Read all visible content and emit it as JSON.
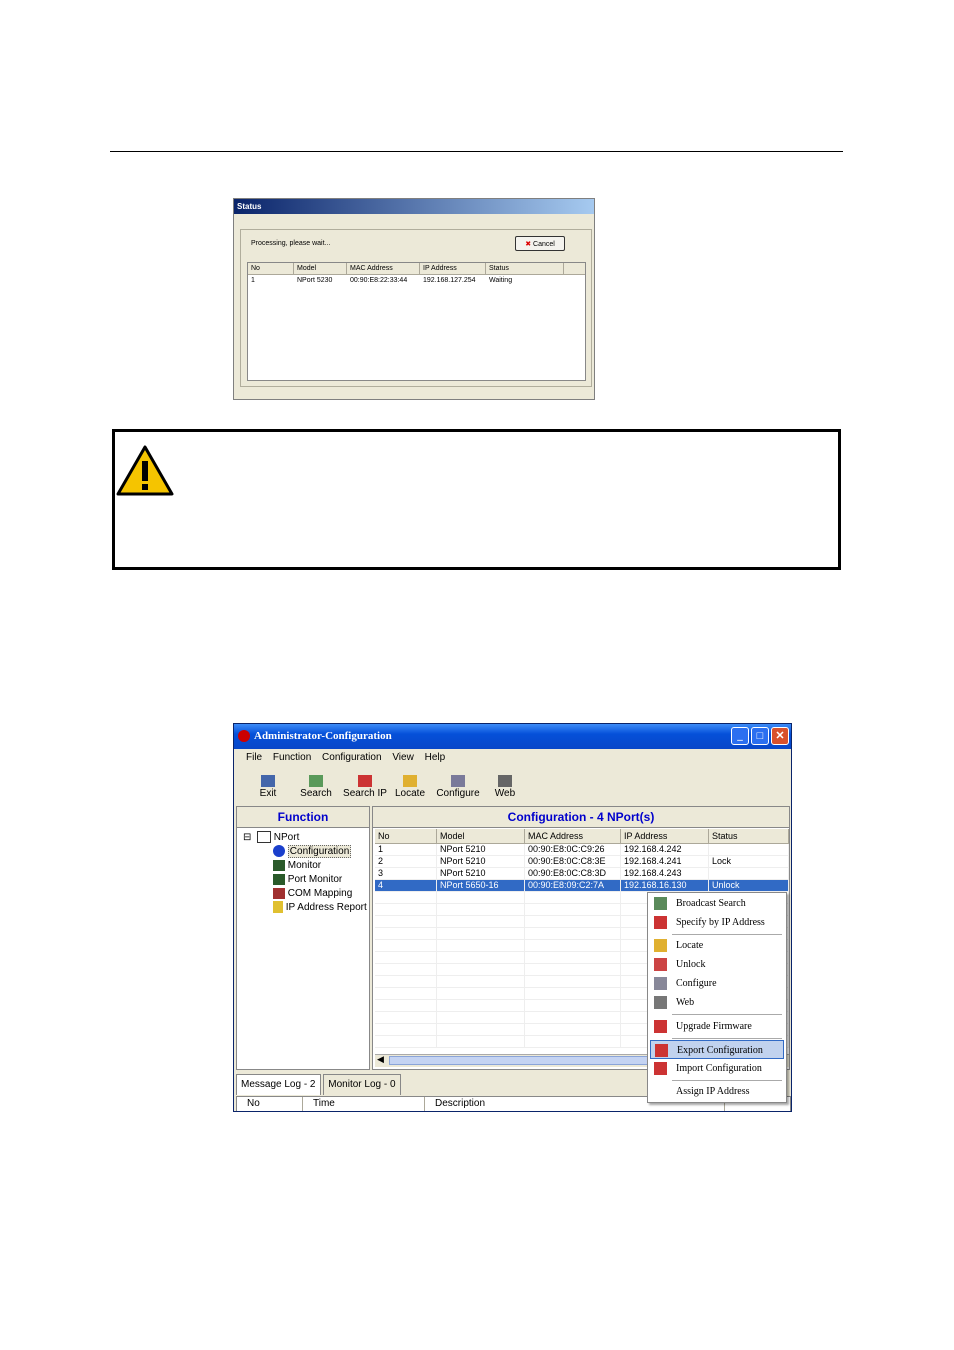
{
  "status_dialog": {
    "title": "Status",
    "message": "Processing, please wait...",
    "cancel_label": "Cancel",
    "columns": [
      "No",
      "Model",
      "MAC Address",
      "IP Address",
      "Status"
    ],
    "rows": [
      [
        "1",
        "NPort 5230",
        "00:90:E8:22:33:44",
        "192.168.127.254",
        "Waiting"
      ]
    ]
  },
  "admin_window": {
    "title": "Administrator-Configuration",
    "menu": [
      "File",
      "Function",
      "Configuration",
      "View",
      "Help"
    ],
    "toolbar": [
      "Exit",
      "Search",
      "Search IP",
      "Locate",
      "Configure",
      "Web"
    ],
    "function_title": "Function",
    "tree": [
      "NPort",
      "Configuration",
      "Monitor",
      "Port Monitor",
      "COM Mapping",
      "IP Address Report"
    ],
    "config_title": "Configuration - 4 NPort(s)",
    "columns": [
      "No",
      "Model",
      "MAC Address",
      "IP Address",
      "Status"
    ],
    "rows": [
      [
        "1",
        "NPort 5210",
        "00:90:E8:0C:C9:26",
        "192.168.4.242",
        ""
      ],
      [
        "2",
        "NPort 5210",
        "00:90:E8:0C:C8:3E",
        "192.168.4.241",
        "Lock"
      ],
      [
        "3",
        "NPort 5210",
        "00:90:E8:0C:C8:3D",
        "192.168.4.243",
        ""
      ],
      [
        "4",
        "NPort 5650-16",
        "00:90:E8:09:C2:7A",
        "192.168.16.130",
        "Unlock"
      ]
    ],
    "tabs": [
      "Message Log - 2",
      "Monitor Log - 0"
    ],
    "log_columns": [
      "No",
      "Time",
      "Description"
    ]
  },
  "context_menu": {
    "items": [
      "Broadcast Search",
      "Specify by IP Address",
      "Locate",
      "Unlock",
      "Configure",
      "Web",
      "Upgrade Firmware",
      "Export Configuration",
      "Import Configuration",
      "Assign IP Address"
    ],
    "highlighted": "Export Configuration"
  },
  "colors": {
    "titlebar": "#0550d9",
    "selection": "#316ac5",
    "function_header": "#0000cc",
    "warning": "#f5c400"
  }
}
